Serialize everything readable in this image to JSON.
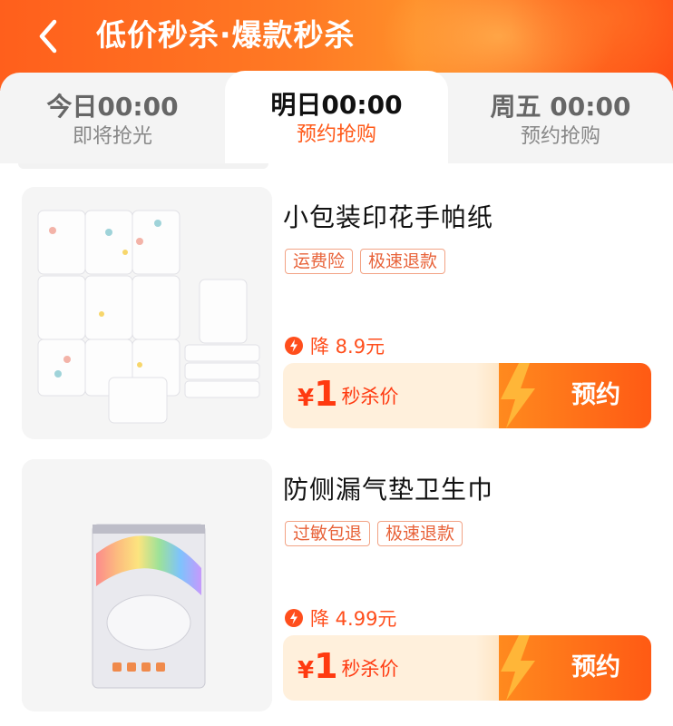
{
  "header": {
    "title": "低价秒杀·爆款秒杀"
  },
  "tabs": [
    {
      "time": "今日00:00",
      "status": "即将抢光"
    },
    {
      "time": "明日00:00",
      "status": "预约抢购"
    },
    {
      "time": "周五 00:00",
      "status": "预约抢购"
    }
  ],
  "products": [
    {
      "name": "小包装印花手帕纸",
      "tags": [
        "运费险",
        "极速退款"
      ],
      "drop_text": "降 8.9元",
      "price_symbol": "¥",
      "price": "1",
      "price_label": "秒杀价",
      "action_label": "预约"
    },
    {
      "name": "防侧漏气垫卫生巾",
      "tags": [
        "过敏包退",
        "极速退款"
      ],
      "drop_text": "降 4.99元",
      "price_symbol": "¥",
      "price": "1",
      "price_label": "秒杀价",
      "action_label": "预约"
    }
  ],
  "colors": {
    "accent": "#ff5a1a",
    "header_start": "#ff5f1c",
    "header_end": "#ff4f16",
    "price": "#ff3a10"
  }
}
